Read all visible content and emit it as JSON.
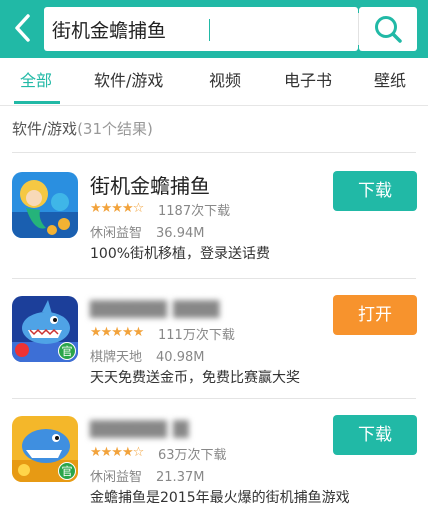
{
  "search": {
    "query": "街机金蟾捕鱼"
  },
  "tabs": [
    "全部",
    "软件/游戏",
    "视频",
    "电子书",
    "壁纸"
  ],
  "section": {
    "title": "软件/游戏",
    "count": "(31个结果)"
  },
  "results": [
    {
      "name": "街机金蟾捕鱼",
      "rating_stars": 3.5,
      "stars": "★★★★☆",
      "downloads": "1187次下载",
      "category": "休闲益智",
      "size": "36.94M",
      "description": "100%街机移植，登录送话费",
      "action": "下载",
      "action_color": "#21b9a6"
    },
    {
      "name": "▆▆▆▆▆ ▆▆▆",
      "rating_stars": 4.5,
      "stars": "★★★★★",
      "downloads": "111万次下载",
      "category": "棋牌天地",
      "size": "40.98M",
      "description": "天天免费送金币，免费比赛赢大奖",
      "action": "打开",
      "action_color": "#f7932d",
      "badge": "官"
    },
    {
      "name": "▆▆▆▆▆ ▆",
      "rating_stars": 3.5,
      "stars": "★★★★☆",
      "downloads": "63万次下载",
      "category": "休闲益智",
      "size": "21.37M",
      "description": "金蟾捕鱼是2015年最火爆的街机捕鱼游戏",
      "action": "下载",
      "action_color": "#21b9a6",
      "badge": "官"
    }
  ]
}
